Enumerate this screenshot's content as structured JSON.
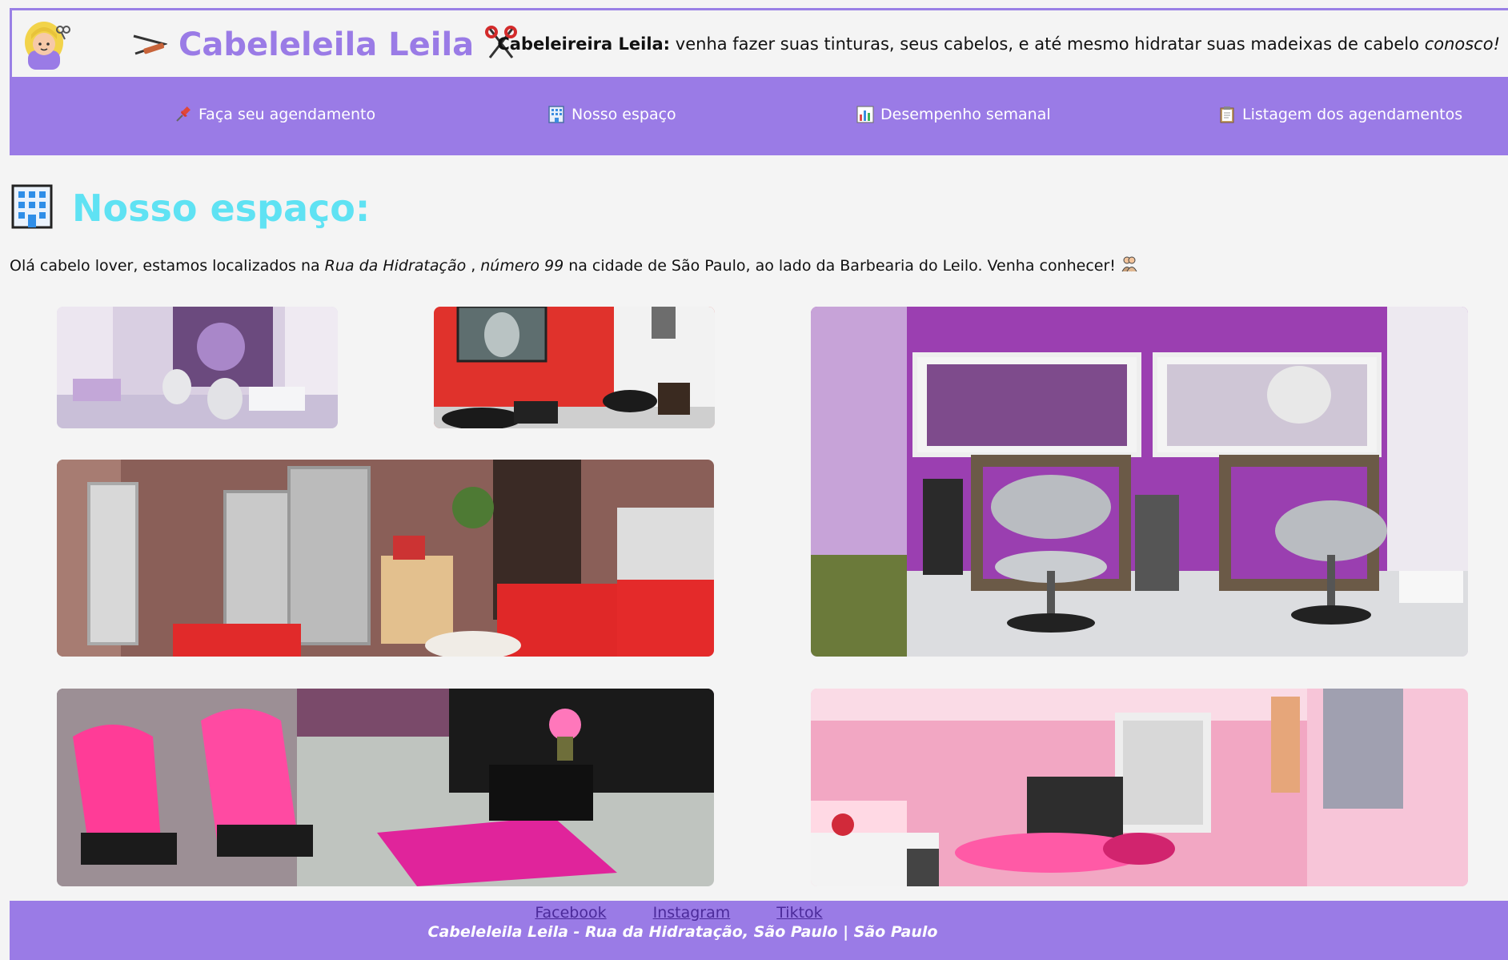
{
  "header": {
    "brand": "Cabeleleila Leila",
    "tagline_strong": "Cabeleireira Leila:",
    "tagline_text": "venha fazer suas tinturas, seus cabelos, e até mesmo hidratar suas madeixas de cabelo",
    "tagline_italic": "conosco!"
  },
  "nav": {
    "items": [
      {
        "label": "Faça seu agendamento",
        "icon": "pushpin-icon"
      },
      {
        "label": "Nosso espaço",
        "icon": "building-icon"
      },
      {
        "label": "Desempenho semanal",
        "icon": "bar-chart-icon"
      },
      {
        "label": "Listagem dos agendamentos",
        "icon": "clipboard-icon"
      }
    ]
  },
  "section": {
    "title": "Nosso espaço:",
    "intro_1": "Olá cabelo lover, estamos localizados na",
    "intro_street": "Rua da Hidratação",
    "intro_2": ",",
    "intro_number": "número 99",
    "intro_3": "na cidade de São Paulo, ao lado da Barbearia do Leilo. Venha conhecer!"
  },
  "photos": [
    {
      "name": "salon-photo-lilac-wash-room"
    },
    {
      "name": "salon-photo-red-wall"
    },
    {
      "name": "salon-photo-purple-stations"
    },
    {
      "name": "salon-photo-mirrors-red-chairs"
    },
    {
      "name": "salon-photo-pink-chairs"
    },
    {
      "name": "salon-photo-pink-panorama"
    }
  ],
  "footer": {
    "links": [
      "Facebook",
      "Instagram",
      "Tiktok"
    ],
    "note": "Cabeleleila Leila - Rua da Hidratação, São Paulo | São Paulo"
  },
  "colors": {
    "accent": "#9a7be6",
    "title": "#5fe2f3",
    "background": "#f4f4f4"
  }
}
